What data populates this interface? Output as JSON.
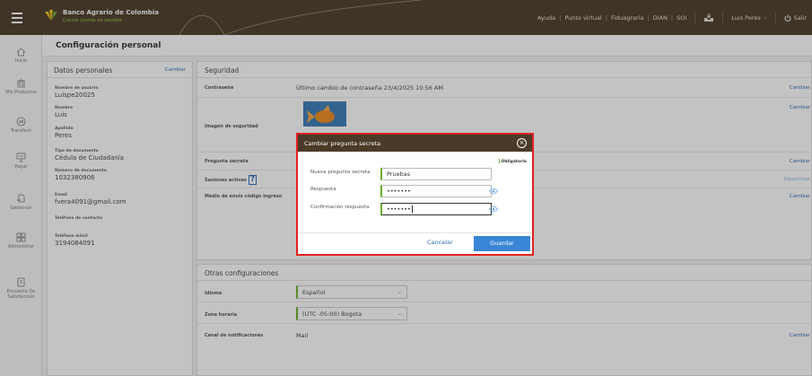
{
  "header": {
    "brand_name": "Banco Agrario de Colombia",
    "brand_tagline": "Crecer juntos es posible",
    "links": [
      "Ayuda",
      "Punto virtual",
      "Fiduagraria",
      "DIAN",
      "SOI"
    ],
    "user_name": "Luis Peres",
    "logout_label": "Salir"
  },
  "sidebar": {
    "items": [
      {
        "label": "Inicio",
        "icon": "home-icon"
      },
      {
        "label": "Mis Productos",
        "icon": "bank-icon"
      },
      {
        "label": "Transferir",
        "icon": "transfer-icon"
      },
      {
        "label": "Pagar",
        "icon": "payment-icon"
      },
      {
        "label": "Gestionar",
        "icon": "manage-icon"
      },
      {
        "label": "Administrar",
        "icon": "grid-icon"
      },
      {
        "label": "Encuesta De Satisfacción",
        "icon": "survey-icon"
      }
    ]
  },
  "page": {
    "title": "Configuración personal"
  },
  "personal": {
    "title": "Datos personales",
    "change_label": "Cambiar",
    "fields": [
      {
        "label": "Nombre de usuario",
        "value": "Luispe20025"
      },
      {
        "label": "Nombre",
        "value": "Luis"
      },
      {
        "label": "Apellido",
        "value": "Peres"
      },
      {
        "label": "Tipo de documento",
        "value": "Cédula de Ciudadanía"
      },
      {
        "label": "Número de documento",
        "value": "1032380906"
      },
      {
        "label": "Email",
        "value": "fvera4091@gmail.com"
      },
      {
        "label": "Teléfono de contacto",
        "value": ""
      },
      {
        "label": "Teléfono móvil",
        "value": "3194084091"
      }
    ]
  },
  "security": {
    "title": "Seguridad",
    "rows": [
      {
        "label": "Contraseña",
        "value": "Último cambio de contraseña 23/4/2025 10:56 AM",
        "action": "Cambiar"
      },
      {
        "label": "Imagen de seguridad",
        "value": "",
        "action": "Cambiar"
      },
      {
        "label": "Pregunta secreta",
        "value": "",
        "action": "Cambiar"
      },
      {
        "label": "Sesiones activas",
        "value": "",
        "action": "Desactivar"
      },
      {
        "label": "Medio de envío código ingreso",
        "value": "",
        "action": "Cambiar"
      }
    ],
    "help_glyph": "?"
  },
  "other": {
    "title": "Otras configuraciones",
    "rows": [
      {
        "label": "Idioma",
        "value": "Español"
      },
      {
        "label": "Zona horaria",
        "value": "(UTC -05:00) Bogota"
      },
      {
        "label": "Canal de notificaciones",
        "value": "Mail",
        "action": "Cambiar"
      }
    ]
  },
  "modal": {
    "title": "Cambiar pregunta secreta",
    "required_label": "Obligatorio",
    "fields": [
      {
        "label": "Nueva pregunta secreta",
        "value": "Pruebas"
      },
      {
        "label": "Respuesta",
        "value": "•••••••"
      },
      {
        "label": "Confirmación respuesta",
        "value": "•••••••"
      }
    ],
    "cancel_label": "Cancelar",
    "save_label": "Guardar"
  },
  "colors": {
    "brand_dark": "#4a3a28",
    "brand_green": "#6cae2d",
    "link_blue": "#2c6db7",
    "primary_button": "#3a86d6",
    "highlight_red": "#e32020"
  }
}
